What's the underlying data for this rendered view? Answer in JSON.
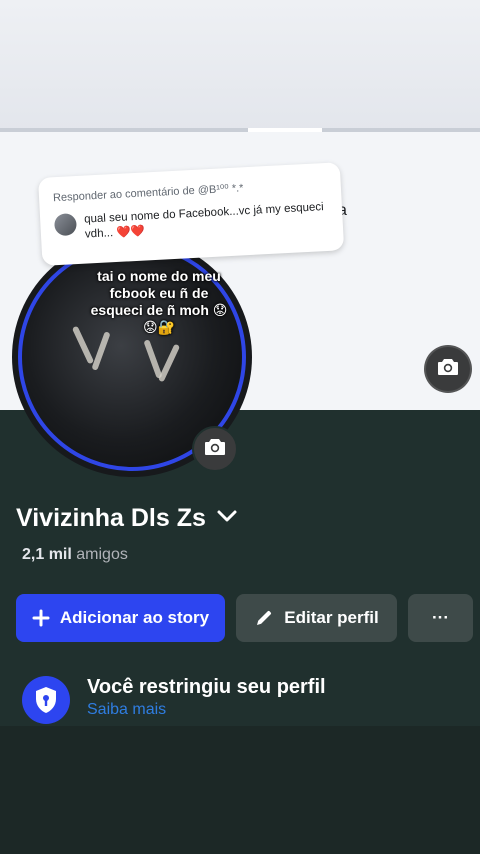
{
  "reply": {
    "title": "Responder ao comentário de @B¹⁰⁰ *.*",
    "comment": "qual seu nome do Facebook...vc já my esqueci vdh...",
    "hearts": "❤️❤️"
  },
  "cover": {
    "partial_letter": "a"
  },
  "avatar_overlay_text": "tai o nome do meu fcbook eu ñ de esqueci de ñ moh 😟 😟🔐",
  "profile": {
    "name": "Vivizinha Dls Zs",
    "friends_count": "2,1 mil",
    "friends_label": "amigos"
  },
  "actions": {
    "add_story": "Adicionar ao story",
    "edit_profile": "Editar perfil",
    "more": "···"
  },
  "restricted": {
    "title": "Você restringiu seu perfil",
    "link": "Saiba mais"
  },
  "colors": {
    "accent": "#2d45f0",
    "link": "#2f7de1",
    "background": "#20302e"
  },
  "icons": [
    "camera-icon",
    "chevron-down-icon",
    "plus-icon",
    "pencil-icon",
    "more-icon",
    "shield-lock-icon"
  ]
}
